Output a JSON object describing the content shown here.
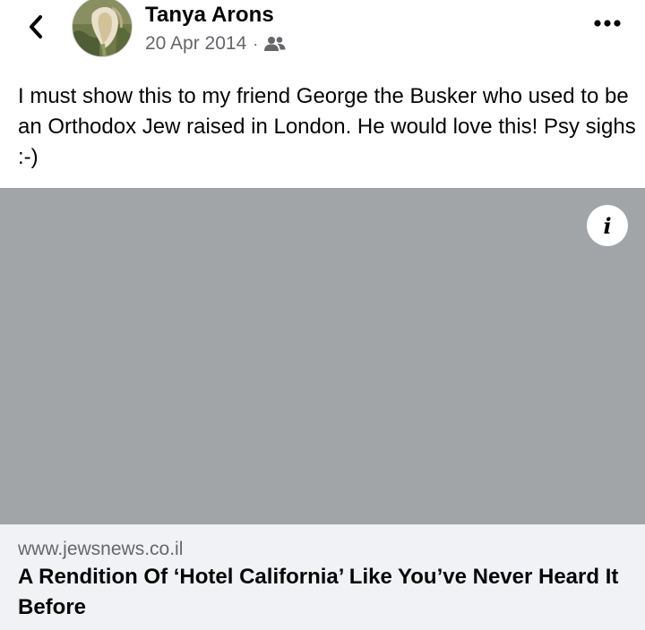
{
  "post": {
    "author": "Tanya Arons",
    "date": "20 Apr 2014",
    "separator": "·",
    "audience_icon": "friends-icon",
    "text": "I must show this to my friend George the Busker who used to be an Orthodox Jew raised in London.  He would love this!  Psy sighs :-)"
  },
  "icons": {
    "back": "chevron-left-icon",
    "more": "more-options-icon",
    "info": "i"
  },
  "link_preview": {
    "domain": "www.jewsnews.co.il",
    "title": "A Rendition Of ‘Hotel California’ Like You’ve Never Heard It Before"
  },
  "colors": {
    "image_placeholder": "#a2a5a8",
    "caption_background": "#f0f2f5",
    "secondary_text": "#65676b"
  }
}
